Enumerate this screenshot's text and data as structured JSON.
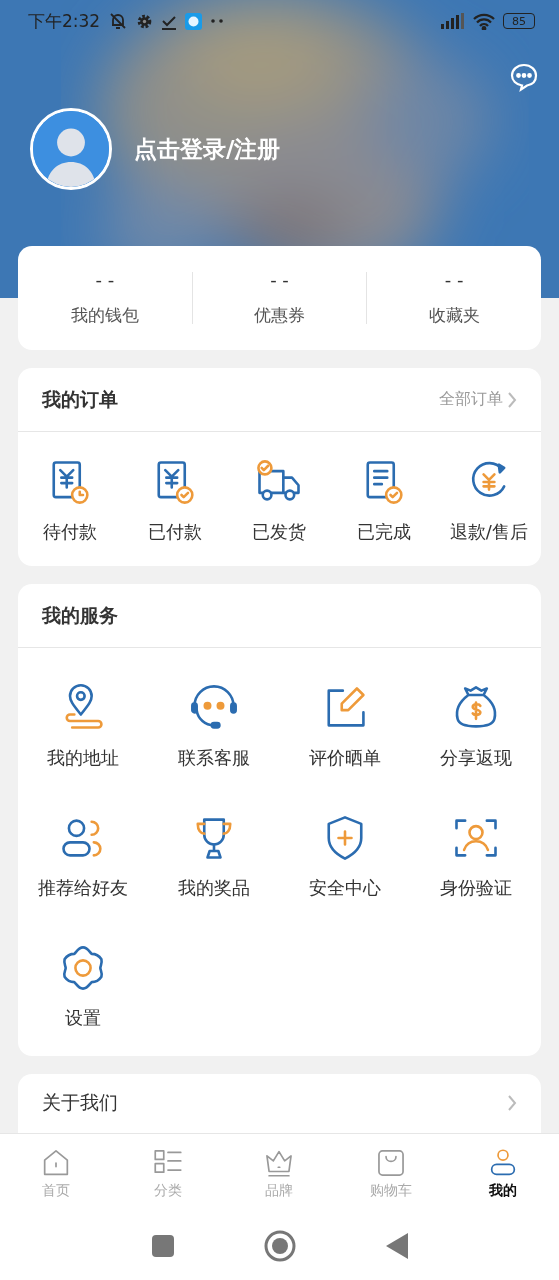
{
  "status_bar": {
    "time": "下午2:32",
    "battery": "85"
  },
  "profile": {
    "login_text": "点击登录/注册"
  },
  "stats": [
    {
      "value": "- -",
      "label": "我的钱包"
    },
    {
      "value": "- -",
      "label": "优惠券"
    },
    {
      "value": "- -",
      "label": "收藏夹"
    }
  ],
  "orders": {
    "title": "我的订单",
    "all_link": "全部订单",
    "items": [
      {
        "label": "待付款"
      },
      {
        "label": "已付款"
      },
      {
        "label": "已发货"
      },
      {
        "label": "已完成"
      },
      {
        "label": "退款/售后"
      }
    ]
  },
  "services": {
    "title": "我的服务",
    "items": [
      {
        "label": "我的地址"
      },
      {
        "label": "联系客服"
      },
      {
        "label": "评价晒单"
      },
      {
        "label": "分享返现"
      },
      {
        "label": "推荐给好友"
      },
      {
        "label": "我的奖品"
      },
      {
        "label": "安全中心"
      },
      {
        "label": "身份验证"
      },
      {
        "label": "设置"
      }
    ]
  },
  "about": {
    "label": "关于我们"
  },
  "tab_bar": [
    {
      "label": "首页",
      "selected": false
    },
    {
      "label": "分类",
      "selected": false
    },
    {
      "label": "品牌",
      "selected": false
    },
    {
      "label": "购物车",
      "selected": false
    },
    {
      "label": "我的",
      "selected": true
    }
  ]
}
